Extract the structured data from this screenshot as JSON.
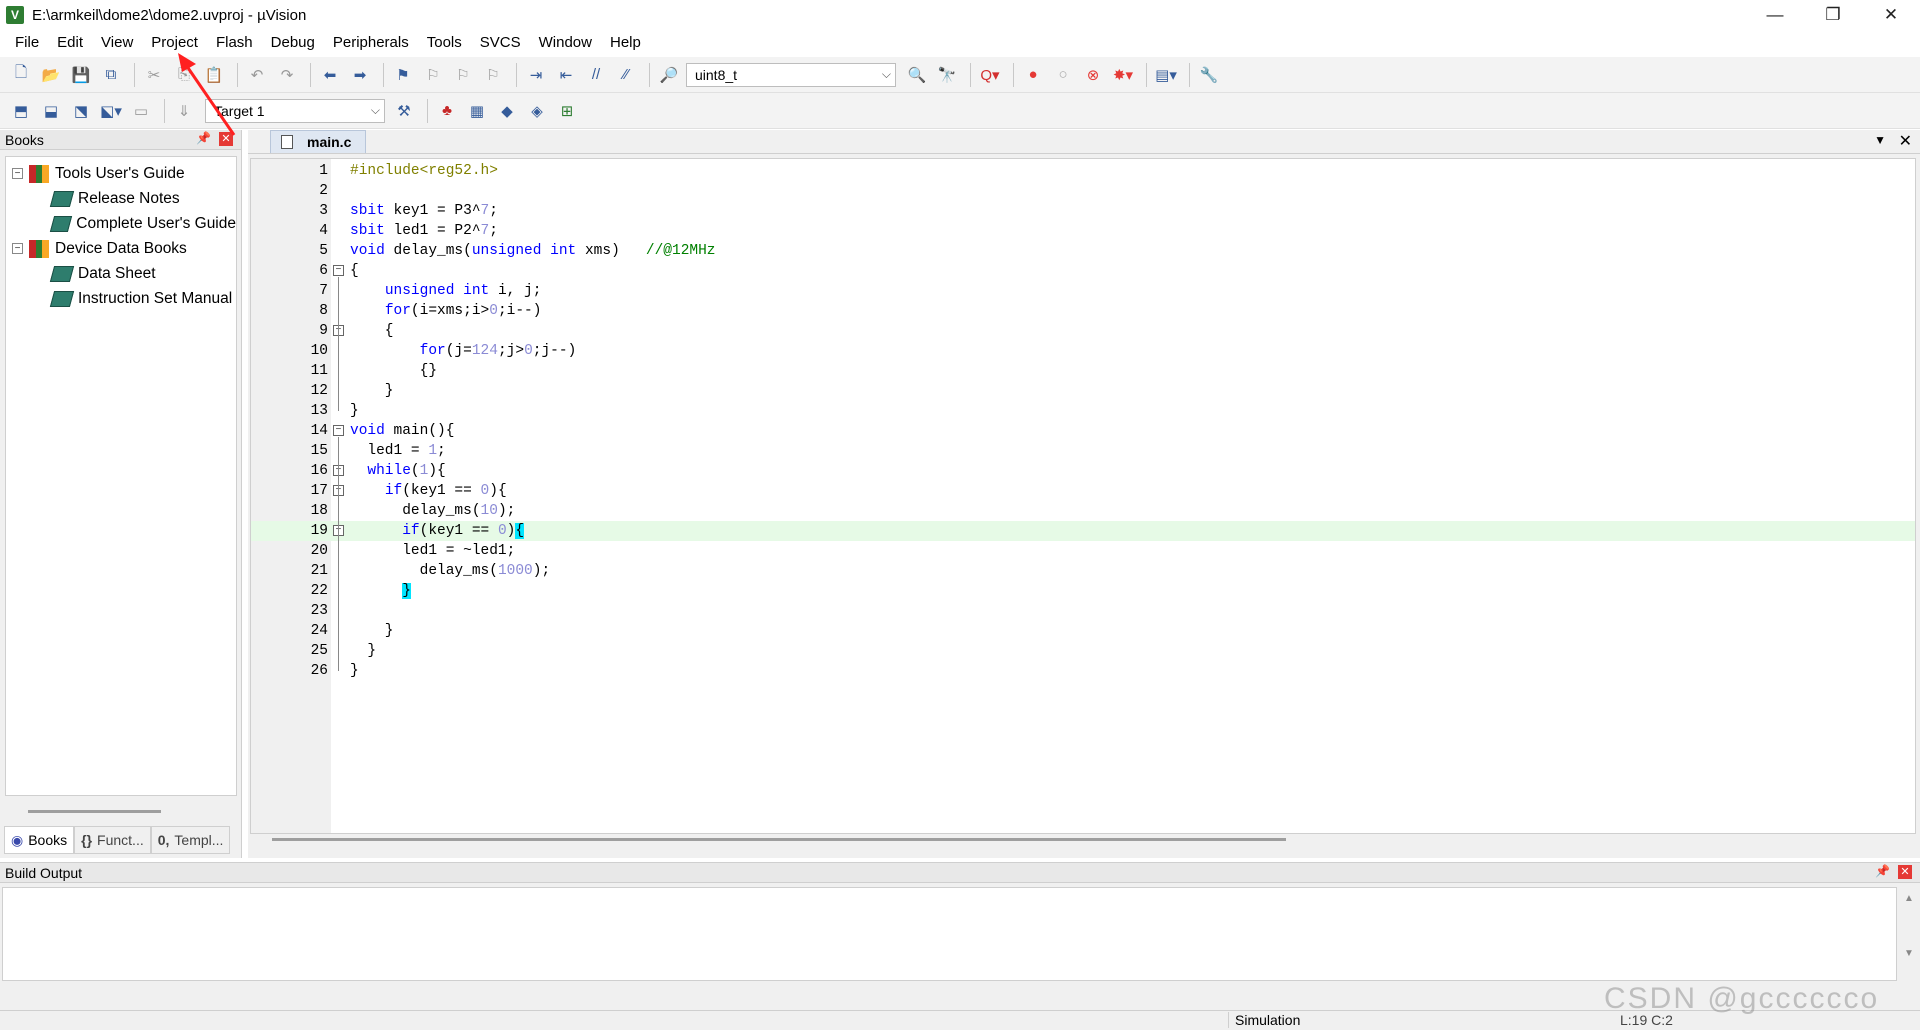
{
  "window": {
    "title": "E:\\armkeil\\dome2\\dome2.uvproj - µVision",
    "controls": [
      "—",
      "❐",
      "✕"
    ]
  },
  "menu": [
    {
      "label": "File"
    },
    {
      "label": "Edit"
    },
    {
      "label": "View"
    },
    {
      "label": "Project"
    },
    {
      "label": "Flash"
    },
    {
      "label": "Debug"
    },
    {
      "label": "Peripherals"
    },
    {
      "label": "Tools"
    },
    {
      "label": "SVCS"
    },
    {
      "label": "Window"
    },
    {
      "label": "Help"
    }
  ],
  "toolbar1": {
    "find_combo_value": "uint8_t"
  },
  "toolbar2": {
    "target_combo_value": "Target 1"
  },
  "books_panel": {
    "title": "Books",
    "tree": [
      {
        "label": "Tools User's Guide",
        "level": 0,
        "expanded": true
      },
      {
        "label": "Release Notes",
        "level": 1
      },
      {
        "label": "Complete User's Guide",
        "level": 1
      },
      {
        "label": "Device Data Books",
        "level": 0,
        "expanded": true
      },
      {
        "label": "Data Sheet",
        "level": 1
      },
      {
        "label": "Instruction Set Manual",
        "level": 1
      }
    ],
    "bottom_tabs": [
      {
        "label": "Books",
        "active": true
      },
      {
        "label": "Funct...",
        "active": false
      },
      {
        "label": "Templ...",
        "active": false
      }
    ]
  },
  "editor": {
    "tab_label": "main.c",
    "highlighted_line": 19,
    "lines": [
      {
        "n": "1",
        "text": "#include<reg52.h>",
        "fold": ""
      },
      {
        "n": "2",
        "text": "",
        "fold": ""
      },
      {
        "n": "3",
        "text": "sbit key1 = P3^7;",
        "fold": ""
      },
      {
        "n": "4",
        "text": "sbit led1 = P2^7;",
        "fold": ""
      },
      {
        "n": "5",
        "text": "void delay_ms(unsigned int xms)   //@12MHz",
        "fold": ""
      },
      {
        "n": "6",
        "text": "{",
        "fold": "box"
      },
      {
        "n": "7",
        "text": "    unsigned int i, j;",
        "fold": ""
      },
      {
        "n": "8",
        "text": "    for(i=xms;i>0;i--)",
        "fold": ""
      },
      {
        "n": "9",
        "text": "    {",
        "fold": "box"
      },
      {
        "n": "10",
        "text": "        for(j=124;j>0;j--)",
        "fold": ""
      },
      {
        "n": "11",
        "text": "        {}",
        "fold": ""
      },
      {
        "n": "12",
        "text": "    }",
        "fold": ""
      },
      {
        "n": "13",
        "text": "}",
        "fold": ""
      },
      {
        "n": "14",
        "text": "void main(){",
        "fold": "box"
      },
      {
        "n": "15",
        "text": "  led1 = 1;",
        "fold": ""
      },
      {
        "n": "16",
        "text": "  while(1){",
        "fold": "box"
      },
      {
        "n": "17",
        "text": "    if(key1 == 0){",
        "fold": "box"
      },
      {
        "n": "18",
        "text": "      delay_ms(10);",
        "fold": ""
      },
      {
        "n": "19",
        "text": "      if(key1 == 0){",
        "fold": "box"
      },
      {
        "n": "20",
        "text": "      led1 = ~led1;",
        "fold": ""
      },
      {
        "n": "21",
        "text": "        delay_ms(1000);",
        "fold": ""
      },
      {
        "n": "22",
        "text": "      }",
        "fold": ""
      },
      {
        "n": "23",
        "text": "",
        "fold": ""
      },
      {
        "n": "24",
        "text": "    }",
        "fold": ""
      },
      {
        "n": "25",
        "text": "  }",
        "fold": ""
      },
      {
        "n": "26",
        "text": "}",
        "fold": ""
      }
    ]
  },
  "build_output": {
    "title": "Build Output"
  },
  "statusbar": {
    "mode": "Simulation",
    "position": "L:19 C:2"
  },
  "watermark": "CSDN @gcccccco",
  "colors": {
    "keyword": "#0000ff",
    "preprocessor": "#808000",
    "comment": "#008000",
    "number": "#8b8bd5",
    "highlight_line": "#e6fae6",
    "brace_match": "#00e5ff",
    "annotation_arrow": "#ff2020"
  }
}
